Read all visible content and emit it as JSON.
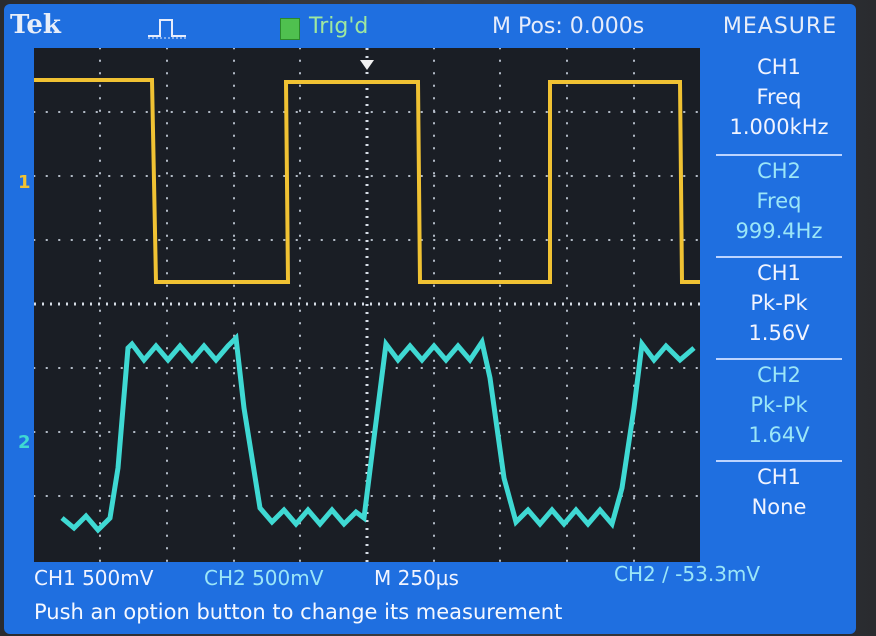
{
  "header": {
    "brand": "Tek",
    "trigger_status": "Trig'd",
    "m_pos": "M Pos: 0.000s"
  },
  "measure": {
    "title": "MEASURE",
    "cells": [
      {
        "channel": "CH1",
        "type": "Freq",
        "value": "1.000kHz"
      },
      {
        "channel": "CH2",
        "type": "Freq",
        "value": "999.4Hz"
      },
      {
        "channel": "CH1",
        "type": "Pk-Pk",
        "value": "1.56V"
      },
      {
        "channel": "CH2",
        "type": "Pk-Pk",
        "value": "1.64V"
      },
      {
        "channel": "CH1",
        "type": "None",
        "value": ""
      }
    ]
  },
  "bottom": {
    "ch1_scale": "CH1  500mV",
    "ch2_scale": "CH2  500mV",
    "timebase": "M 250µs",
    "trigger": "CH2 ∕ -53.3mV"
  },
  "status_message": "Push an option button to change its measurement",
  "markers": {
    "ch1": "1",
    "ch2": "2"
  },
  "colors": {
    "ch1": "#f0c233",
    "ch2": "#3fd9d3",
    "screen": "#1f6fe0",
    "grid_bg": "#1a1e25"
  }
}
